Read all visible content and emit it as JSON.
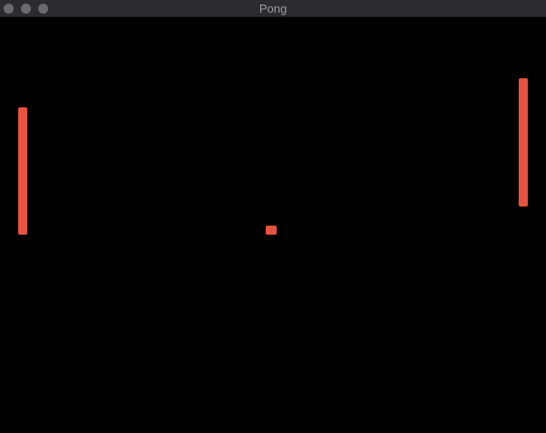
{
  "window": {
    "title": "Pong"
  },
  "game": {
    "object_color": "#e8533f",
    "background_color": "#000000"
  }
}
